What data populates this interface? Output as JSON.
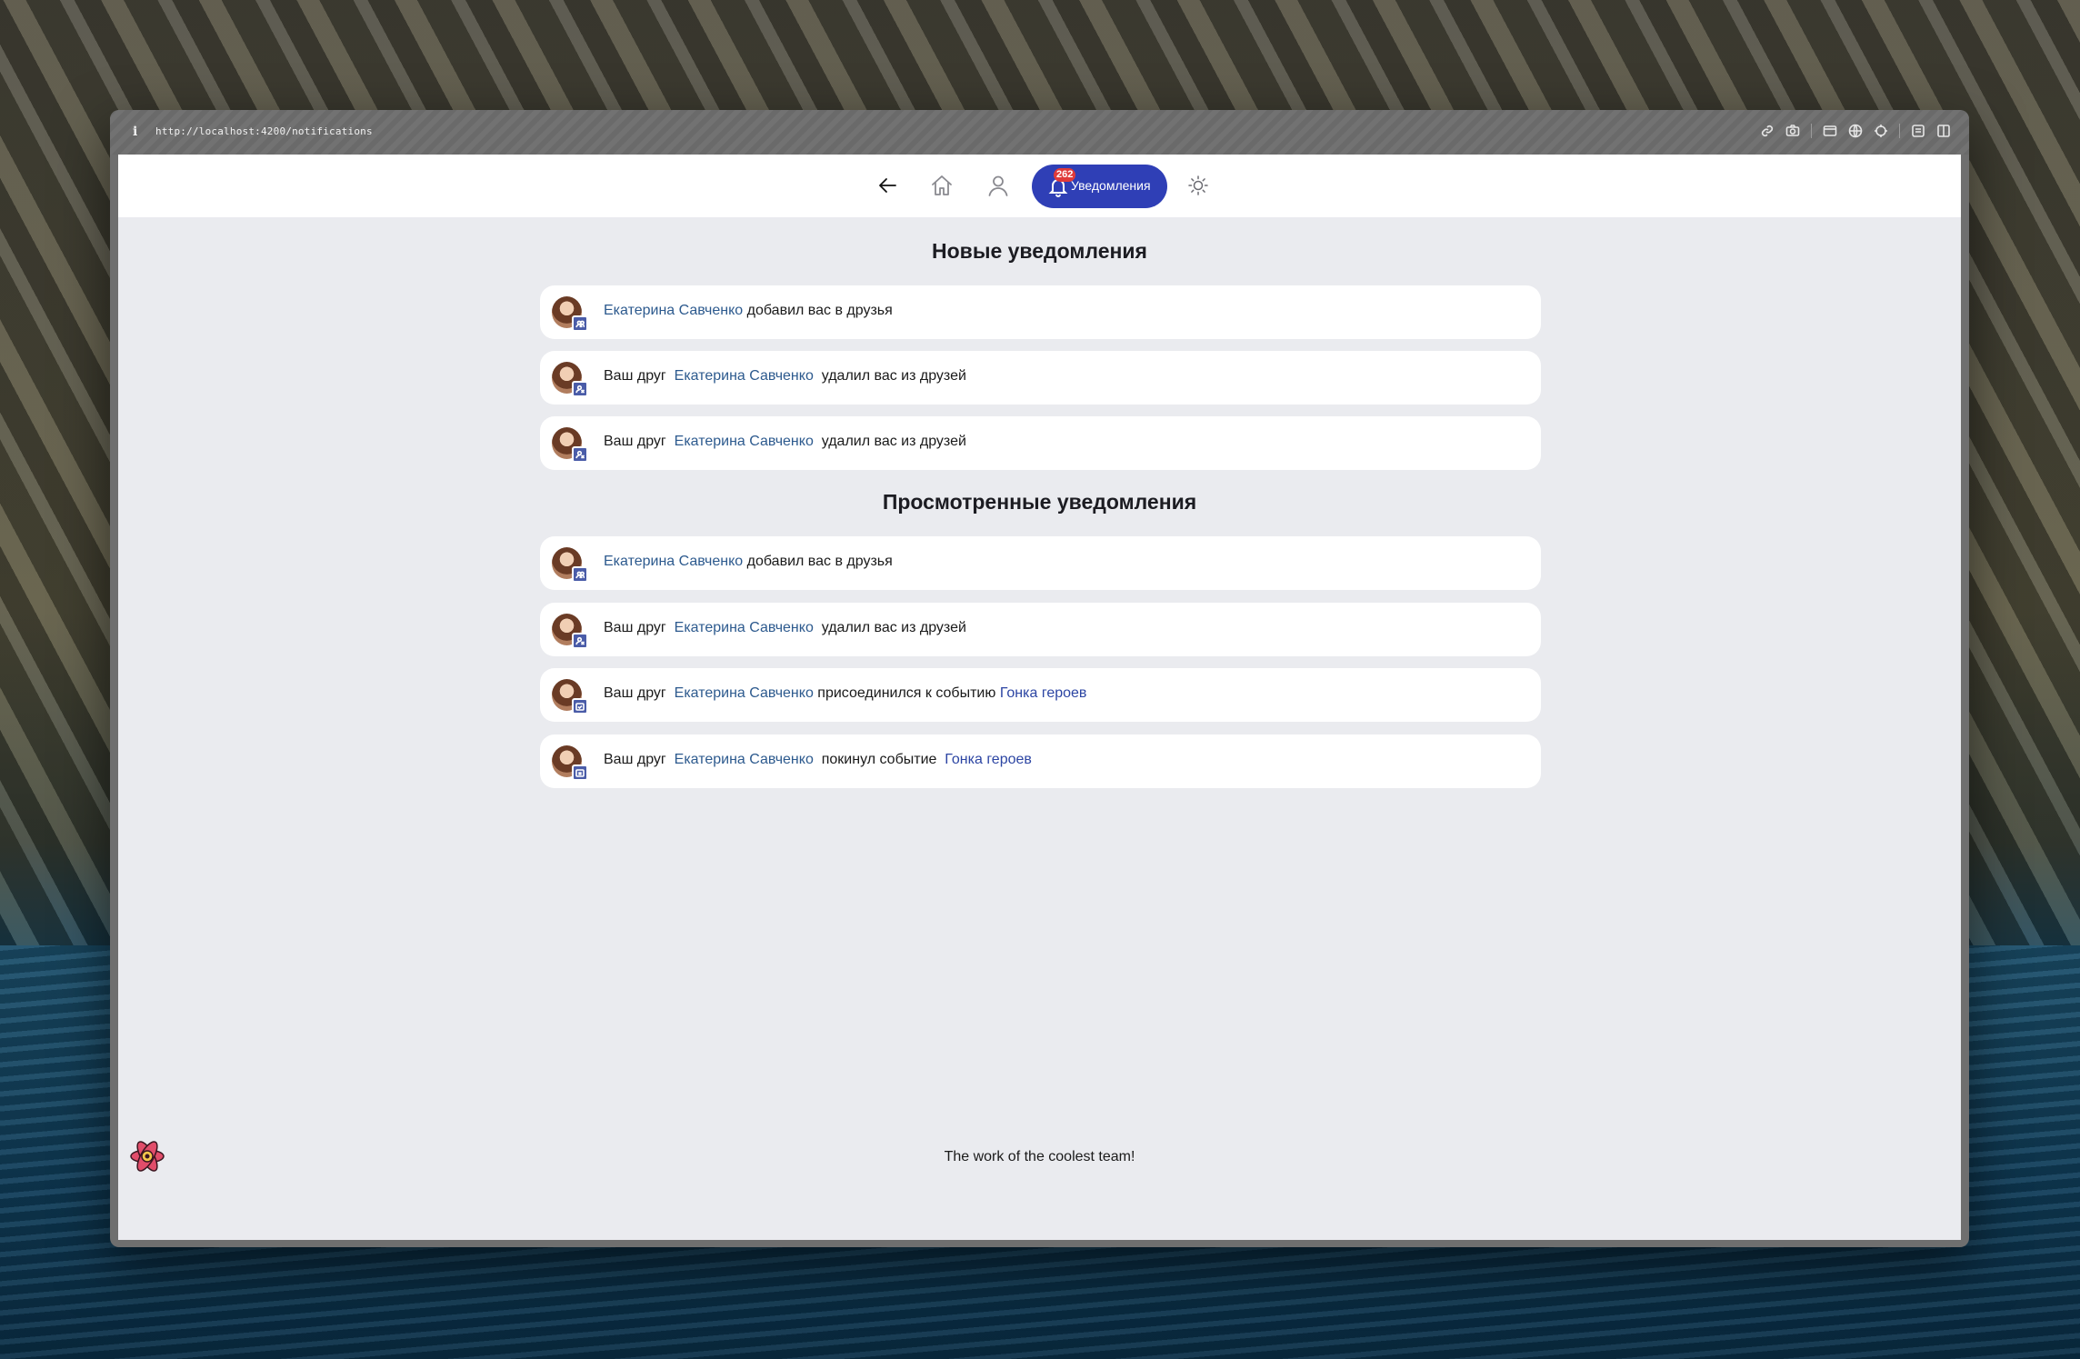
{
  "browser": {
    "url": "http://localhost:4200/notifications"
  },
  "navbar": {
    "back_icon": "arrow-left-icon",
    "home_icon": "home-icon",
    "profile_icon": "user-icon",
    "notifications": {
      "label": "Уведомления",
      "badge": "262",
      "icon": "bell-icon",
      "accent_color": "#2f3fb6"
    },
    "theme_icon": "sun-icon"
  },
  "sections": {
    "new_title": "Новые уведомления",
    "viewed_title": "Просмотренные уведомления"
  },
  "new_notifications": [
    {
      "prefix": "",
      "user": "Екатерина Савченко",
      "action": " добавил вас в друзья",
      "event": "",
      "badge_icon": "users-icon"
    },
    {
      "prefix": "Ваш друг  ",
      "user": "Екатерина Савченко",
      "action": "  удалил вас из друзей",
      "event": "",
      "badge_icon": "user-remove-icon"
    },
    {
      "prefix": "Ваш друг  ",
      "user": "Екатерина Савченко",
      "action": "  удалил вас из друзей",
      "event": "",
      "badge_icon": "user-remove-icon"
    }
  ],
  "viewed_notifications": [
    {
      "prefix": "",
      "user": "Екатерина Савченко",
      "action": " добавил вас в друзья",
      "event": "",
      "badge_icon": "users-icon"
    },
    {
      "prefix": "Ваш друг  ",
      "user": "Екатерина Савченко",
      "action": "  удалил вас из друзей",
      "event": "",
      "badge_icon": "user-remove-icon"
    },
    {
      "prefix": "Ваш друг  ",
      "user": "Екатерина Савченко",
      "action": " присоединился к событию ",
      "event": "Гонка героев",
      "badge_icon": "calendar-check-icon"
    },
    {
      "prefix": "Ваш друг  ",
      "user": "Екатерина Савченко",
      "action": "  покинул событие  ",
      "event": "Гонка героев",
      "badge_icon": "calendar-x-icon"
    }
  ],
  "footer": {
    "text": "The work of the coolest team!",
    "logo_icon": "atom-flower-logo"
  }
}
